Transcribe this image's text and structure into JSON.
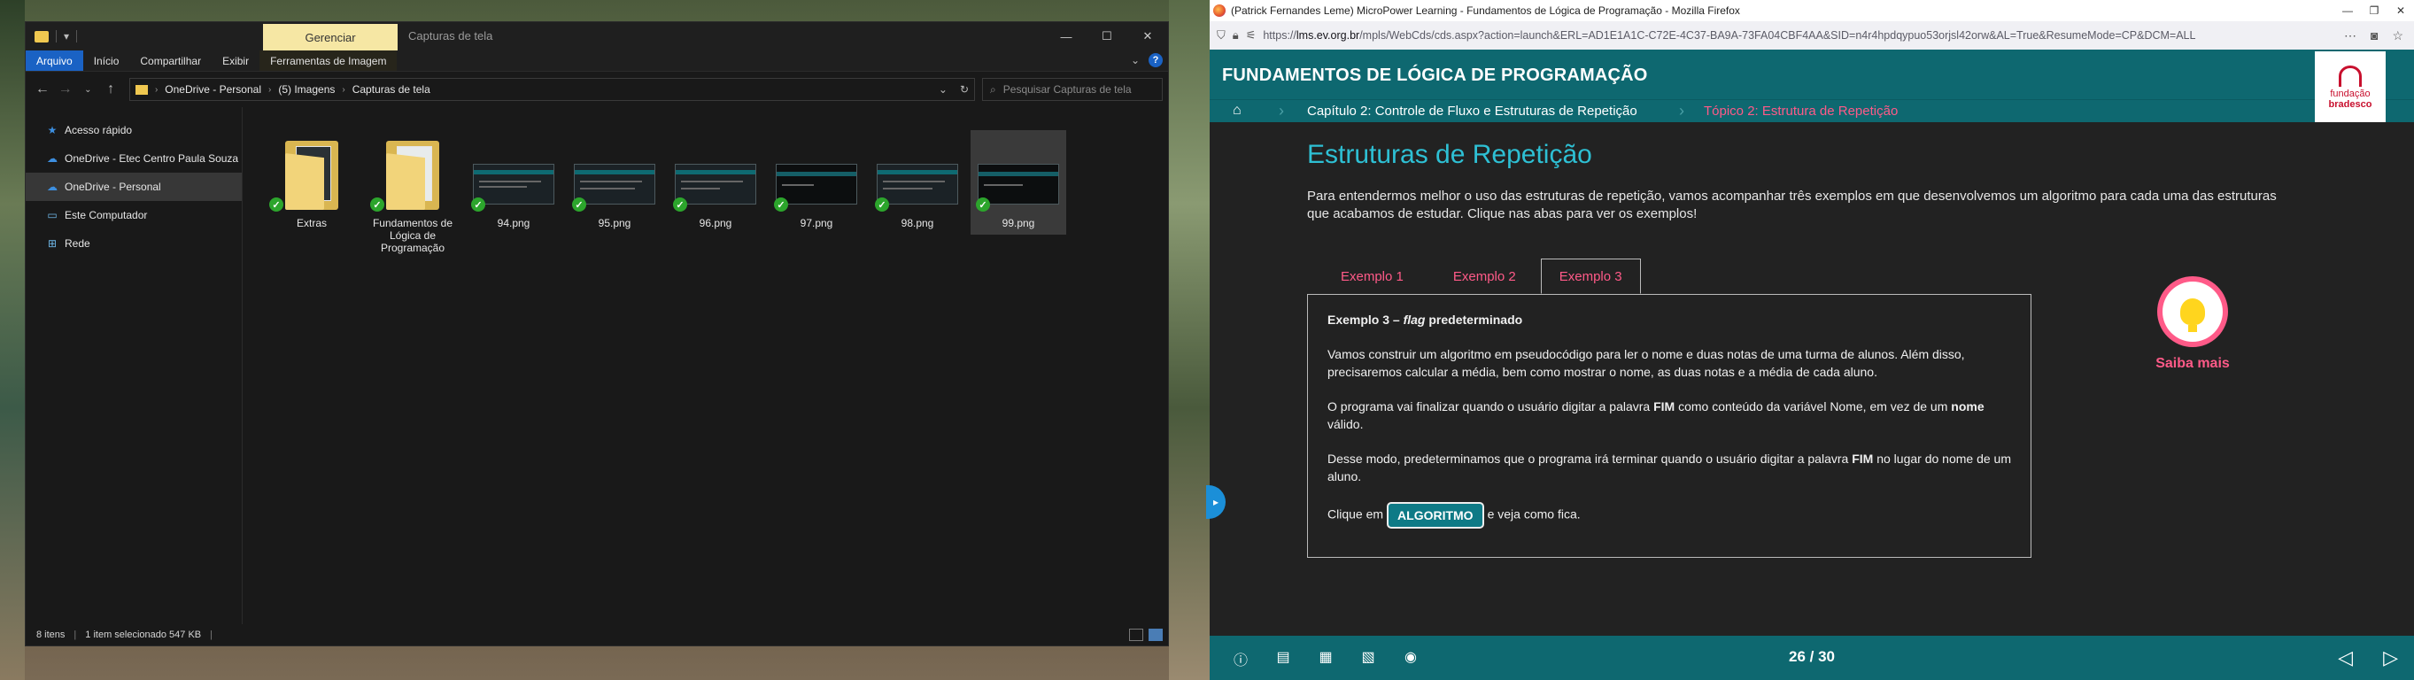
{
  "explorer": {
    "ribbon_context_label": "Gerenciar",
    "window_title": "Capturas de tela",
    "tabs": [
      "Arquivo",
      "Início",
      "Compartilhar",
      "Exibir",
      "Ferramentas de Imagem"
    ],
    "address": [
      "OneDrive - Personal",
      "(5) Imagens",
      "Capturas de tela"
    ],
    "search_placeholder": "Pesquisar Capturas de tela",
    "nav": [
      {
        "label": "Acesso rápido",
        "icon": "star-icon"
      },
      {
        "label": "OneDrive - Etec Centro Paula Souza",
        "icon": "cloud-icon"
      },
      {
        "label": "OneDrive - Personal",
        "icon": "cloud-icon"
      },
      {
        "label": "Este Computador",
        "icon": "computer-icon"
      },
      {
        "label": "Rede",
        "icon": "network-icon"
      }
    ],
    "files": [
      {
        "name": "Extras",
        "type": "folder"
      },
      {
        "name": "Fundamentos de Lógica de Programação",
        "type": "folder"
      },
      {
        "name": "94.png",
        "type": "image"
      },
      {
        "name": "95.png",
        "type": "image"
      },
      {
        "name": "96.png",
        "type": "image"
      },
      {
        "name": "97.png",
        "type": "image"
      },
      {
        "name": "98.png",
        "type": "image"
      },
      {
        "name": "99.png",
        "type": "image"
      }
    ],
    "status": {
      "items": "8 itens",
      "selected": "1 item selecionado  547 KB"
    }
  },
  "firefox": {
    "window_title": "(Patrick Fernandes Leme) MicroPower Learning - Fundamentos de Lógica de Programação - Mozilla Firefox",
    "url_prefix": "https://",
    "url_host": "lms.ev.org.br",
    "url_rest": "/mpls/WebCds/cds.aspx?action=launch&ERL=AD1E1A1C-C72E-4C37-BA9A-73FA04CBF4AA&SID=n4r4hpdqypuo53orjsl42orw&AL=True&ResumeMode=CP&DCM=ALL"
  },
  "course": {
    "title": "FUNDAMENTOS DE LÓGICA DE PROGRAMAÇÃO",
    "breadcrumb_chapter": "Capítulo 2: Controle de Fluxo e Estruturas de Repetição",
    "breadcrumb_topic": "Tópico 2: Estrutura de Repetição",
    "logo_line1": "fundação",
    "logo_line2": "bradesco",
    "heading": "Estruturas de Repetição",
    "intro": "Para entendermos melhor o uso das estruturas de repetição, vamos acompanhar três exemplos em que desenvolvemos um algoritmo para cada uma das estruturas que acabamos de estudar. Clique nas abas para ver os exemplos!",
    "tabs": [
      "Exemplo 1",
      "Exemplo 2",
      "Exemplo 3"
    ],
    "panel": {
      "title_prefix": "Exemplo 3 – ",
      "title_flag": "flag",
      "title_suffix": " predeterminado",
      "p1": "Vamos construir um algoritmo em pseudocódigo para ler o nome e duas notas de uma turma de alunos. Além disso, precisaremos calcular a média, bem como mostrar o nome, as duas notas e a média de cada aluno.",
      "p2_a": "O programa vai finalizar quando o usuário digitar a palavra ",
      "p2_b": "FIM",
      "p2_c": " como conteúdo da variável Nome, em vez de um ",
      "p2_d": "nome",
      "p2_e": " válido.",
      "p3_a": "Desse modo, predeterminamos que o programa irá terminar quando o usuário digitar a palavra ",
      "p3_b": "FIM",
      "p3_c": " no lugar do nome de um aluno.",
      "p4_a": "Clique em",
      "button": "ALGORITMO",
      "p4_b": "e veja como fica."
    },
    "saiba_mais": "Saiba mais",
    "pager": "26 / 30"
  }
}
